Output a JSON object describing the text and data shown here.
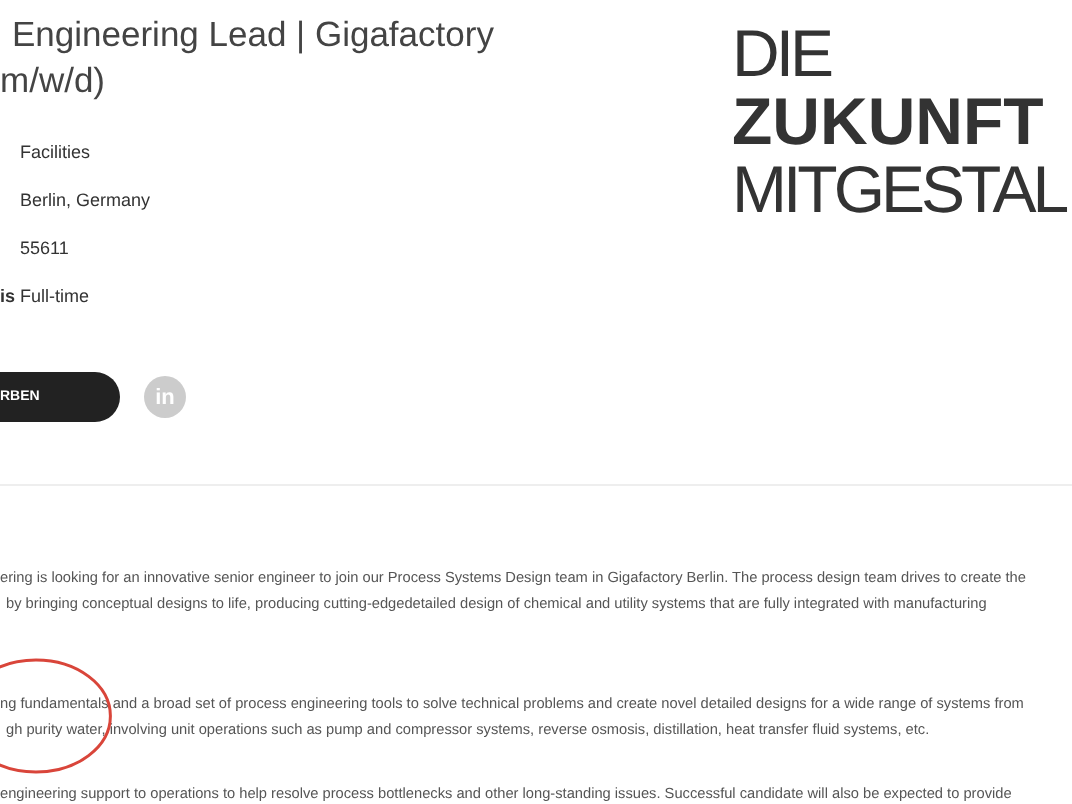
{
  "job_title": [
    "Engineering Lead | Gigafactory",
    "m/w/d)"
  ],
  "details": [
    {
      "value": "Facilities"
    },
    {
      "value": "Berlin, Germany"
    },
    {
      "value": "55611"
    },
    {
      "label": "is",
      "value": "Full-time"
    }
  ],
  "apply_button": {
    "label": "RBEN"
  },
  "share": {
    "kind": "linkedin",
    "label": "in"
  },
  "logo": {
    "lines": [
      {
        "text": "DIE",
        "bold": false
      },
      {
        "text": "ZUKUNFT",
        "bold": true
      },
      {
        "text": "MITGESTAL",
        "bold": false
      }
    ]
  },
  "description": [
    [
      "ering is looking for an innovative senior engineer to join our Process Systems Design team in Gigafactory Berlin. The process design team drives to create the",
      "by bringing conceptual designs to life, producing cutting-edgedetailed design of chemical and utility systems that are fully integrated with manufacturing"
    ],
    [
      "ng fundamentals and a broad set of process engineering tools to solve technical problems and create novel detailed designs for a wide range of systems from",
      "gh purity water, involving unit operations such as pump and compressor systems, reverse osmosis, distillation, heat transfer fluid systems, etc."
    ],
    [
      "engineering support to operations to help resolve process bottlenecks and other long-standing issues. Successful candidate will also be expected to provide"
    ]
  ],
  "annotation": {
    "kind": "ellipse"
  }
}
